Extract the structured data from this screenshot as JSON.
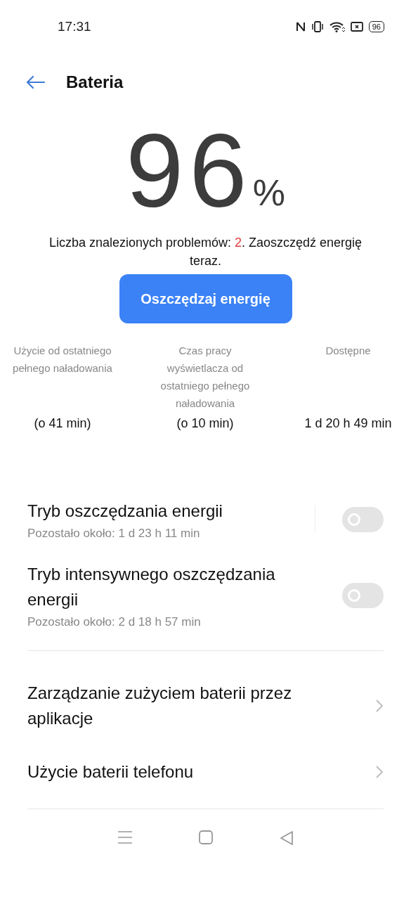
{
  "status_bar": {
    "time": "17:31",
    "battery": "96"
  },
  "header": {
    "title": "Bateria"
  },
  "battery_level": {
    "value": "96",
    "unit": "%"
  },
  "problems": {
    "text_before": "Liczba znalezionych problemów: ",
    "count": "2",
    "text_after": ". Zaoszczędź energię teraz."
  },
  "save_button": "Oszczędzaj energię",
  "stats": [
    {
      "label": "Użycie od ostatniego pełnego naładowania",
      "value": "(o 41 min)"
    },
    {
      "label": "Czas pracy wyświetlacza od ostatniego pełnego naładowania",
      "value": "(o 10 min)"
    },
    {
      "label": "Dostępne",
      "value": "1 d 20 h 49 min"
    }
  ],
  "modes": [
    {
      "title": "Tryb oszczędzania energii",
      "subtitle": "Pozostało około:  1 d 23 h 11 min",
      "on": false,
      "separator": true
    },
    {
      "title": "Tryb intensywnego oszczędzania energii",
      "subtitle": "Pozostało około:  2 d 18 h 57 min",
      "on": false,
      "separator": false
    }
  ],
  "links": [
    {
      "label": "Zarządzanie zużyciem baterii przez aplikacje"
    },
    {
      "label": "Użycie baterii telefonu"
    }
  ]
}
